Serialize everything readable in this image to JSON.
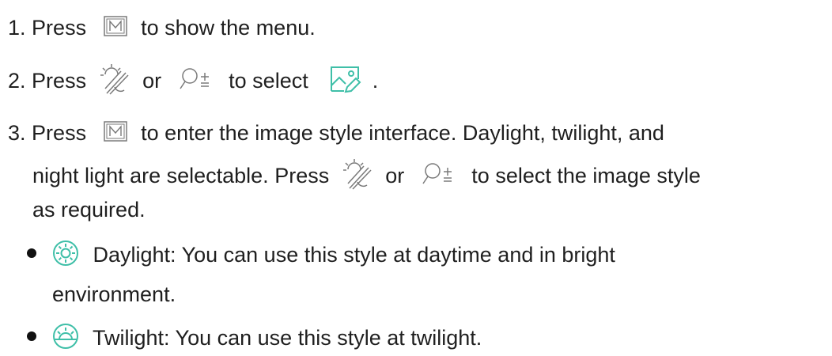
{
  "steps": [
    {
      "number": "1.",
      "text_before": "Press",
      "icon": "m-button-icon",
      "text_after": "to show the menu."
    },
    {
      "number": "2.",
      "text_before": "Press",
      "icon_a": "brightness-icon",
      "or": "or",
      "icon_b": "zoom-icon",
      "text_mid": "to select",
      "icon_c": "image-style-icon",
      "end": "."
    },
    {
      "number": "3.",
      "text_before": "Press",
      "icon": "m-button-icon",
      "text_after": "to enter the image style interface. Daylight, twilight, and",
      "line2_before": "night light are selectable. Press",
      "or": "or",
      "line2_after": "to select the image style",
      "line3": "as required."
    }
  ],
  "styles": [
    {
      "icon": "daylight-icon",
      "text": "Daylight: You can use this style at daytime and in bright",
      "text_cont": "environment."
    },
    {
      "icon": "twilight-icon",
      "text": "Twilight: You can use this style at twilight."
    }
  ],
  "colors": {
    "accent": "#3fbfa8",
    "text": "#1f1f1f",
    "icon_gray": "#7a7a7a"
  }
}
